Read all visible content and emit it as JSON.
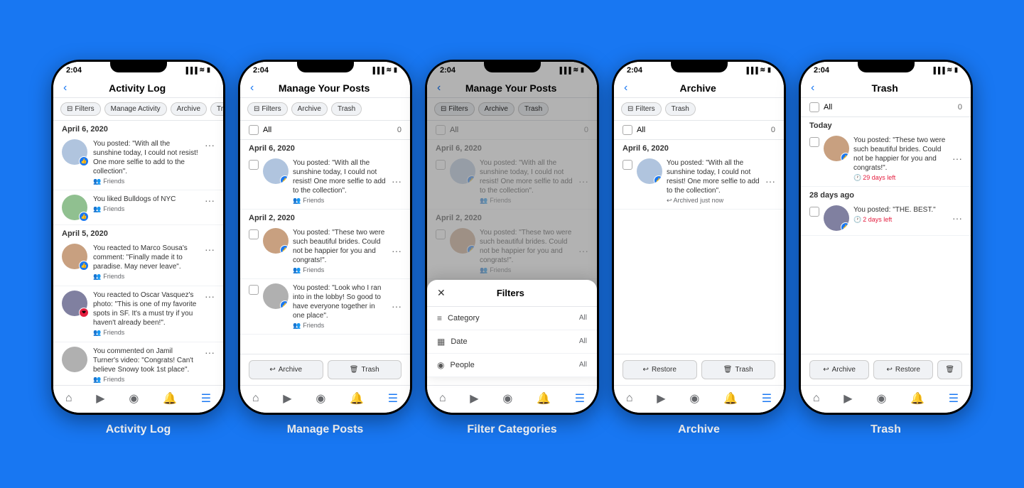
{
  "background": "#1877F2",
  "phones": [
    {
      "id": "activity-log",
      "label": "Activity Log",
      "statusTime": "2:04",
      "navTitle": "Activity Log",
      "showBack": true,
      "chips": [
        {
          "label": "Filters",
          "icon": "⊟",
          "active": false
        },
        {
          "label": "Manage Activity",
          "active": false
        },
        {
          "label": "Archive",
          "active": false
        },
        {
          "label": "Tr...",
          "active": false
        }
      ],
      "type": "activity"
    },
    {
      "id": "manage-posts",
      "label": "Manage Posts",
      "statusTime": "2:04",
      "navTitle": "Manage Your Posts",
      "showBack": true,
      "chips": [
        {
          "label": "Filters",
          "icon": "⊟",
          "active": false
        },
        {
          "label": "Archive",
          "active": false
        },
        {
          "label": "Trash",
          "active": false
        }
      ],
      "selectAll": {
        "label": "All",
        "count": "0"
      },
      "type": "manage"
    },
    {
      "id": "filter-categories",
      "label": "Filter Categories",
      "statusTime": "2:04",
      "navTitle": "Manage Your Posts",
      "showBack": true,
      "chips": [
        {
          "label": "Filters",
          "icon": "⊟",
          "active": false
        },
        {
          "label": "Archive",
          "active": false
        },
        {
          "label": "Trash",
          "active": false
        }
      ],
      "type": "filter",
      "filterTitle": "Filters",
      "filterRows": [
        {
          "icon": "≡",
          "label": "Category",
          "value": "All"
        },
        {
          "icon": "▦",
          "label": "Date",
          "value": "All"
        },
        {
          "icon": "◉",
          "label": "People",
          "value": "All"
        }
      ]
    },
    {
      "id": "archive",
      "label": "Archive",
      "statusTime": "2:04",
      "navTitle": "Archive",
      "showBack": true,
      "chips": [
        {
          "label": "Filters",
          "icon": "⊟",
          "active": false
        },
        {
          "label": "Trash",
          "active": false
        }
      ],
      "selectAll": {
        "label": "All",
        "count": "0"
      },
      "type": "archive"
    },
    {
      "id": "trash",
      "label": "Trash",
      "statusTime": "2:04",
      "navTitle": "Trash",
      "showBack": true,
      "chips": [],
      "selectAll": {
        "label": "All",
        "count": "0"
      },
      "type": "trash"
    }
  ],
  "posts": {
    "april6_post1": "You posted: \"With all the sunshine today, I could not resist! One more selfie to add to the collection\".",
    "april6_post2": "You liked Bulldogs of NYC",
    "april5_react1": "You reacted to Marco Sousa's comment: \"Finally made it to paradise. May never leave\".",
    "april5_react2": "You reacted to Oscar Vasquez's photo: \"This is one of my favorite spots in SF. It's a must try if you haven't already been!\".",
    "april5_comment": "You commented on Jamil Turner's video: \"Congrats! Can't believe Snowy took 1st place\".",
    "manage_post1": "You posted: \"With all the sunshine today, I could not resist! One more selfie to add to the collection\".",
    "manage_post2": "You posted: \"These two were such beautiful brides. Could not be happier for you and congrats!\".",
    "manage_post3": "You posted: \"Look who I ran into in the lobby! So good to have everyone together in one place\".",
    "archive_post1": "You posted: \"With all the sunshine today, I could not resist! One more selfie to add to the collection\".",
    "trash_post1": "You posted: \"These two were such beautiful brides. Could not be happier for you and congrats!\".",
    "trash_post2": "You posted: \"THE. BEST.\""
  },
  "labels": {
    "friends": "Friends",
    "archive_btn": "Archive",
    "trash_btn": "Trash",
    "restore_btn": "Restore",
    "archived_now": "Archived just now",
    "days_left_29": "29 days left",
    "days_left_2": "2 days left",
    "today": "Today",
    "28_days_ago": "28 days ago",
    "april6": "April 6, 2020",
    "april5": "April 5, 2020",
    "april2": "April 2, 2020"
  },
  "nav_icons": [
    "⌂",
    "▶",
    "◉",
    "🔔",
    "☰"
  ]
}
